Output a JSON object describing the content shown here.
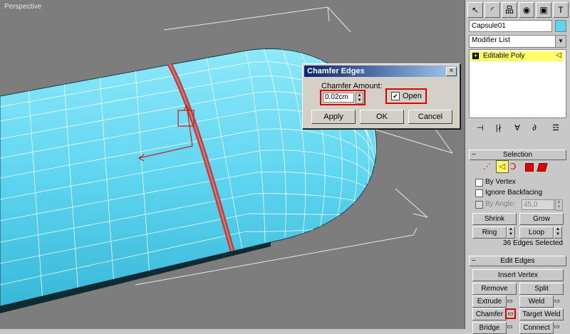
{
  "viewport": {
    "label": "Perspective"
  },
  "dialog": {
    "title": "Chamfer Edges",
    "close_glyph": "×",
    "amount_label": "Chamfer Amount:",
    "amount_value": "0,02cm",
    "open_checked": true,
    "open_label": "Open",
    "apply_label": "Apply",
    "ok_label": "OK",
    "cancel_label": "Cancel"
  },
  "panel": {
    "tabs": [
      "↖",
      "◜",
      "品",
      "◉",
      "▣",
      "T"
    ],
    "object_name": "Capsule01",
    "modifier_list": "Modifier List",
    "stack_item": "Editable Poly",
    "stack_item_glyph": "+",
    "tool_icons": [
      "⊣",
      "|∤",
      "∀",
      "∂",
      "☲"
    ],
    "selection": {
      "title": "Selection",
      "by_vertex": "By Vertex",
      "ignore_backfacing": "Ignore Backfacing",
      "by_angle": "By Angle:",
      "by_angle_value": "45,0",
      "shrink": "Shrink",
      "grow": "Grow",
      "ring": "Ring",
      "loop": "Loop",
      "status": "36 Edges Selected"
    },
    "edit_edges": {
      "title": "Edit Edges",
      "insert_vertex": "Insert Vertex",
      "remove": "Remove",
      "split": "Split",
      "extrude": "Extrude",
      "weld": "Weld",
      "chamfer": "Chamfer",
      "target_weld": "Target Weld",
      "bridge": "Bridge",
      "connect": "Connect"
    }
  },
  "colors": {
    "capsule": "#5ed5f0",
    "highlight": "#e00000",
    "stack_selected": "#ffff66"
  }
}
